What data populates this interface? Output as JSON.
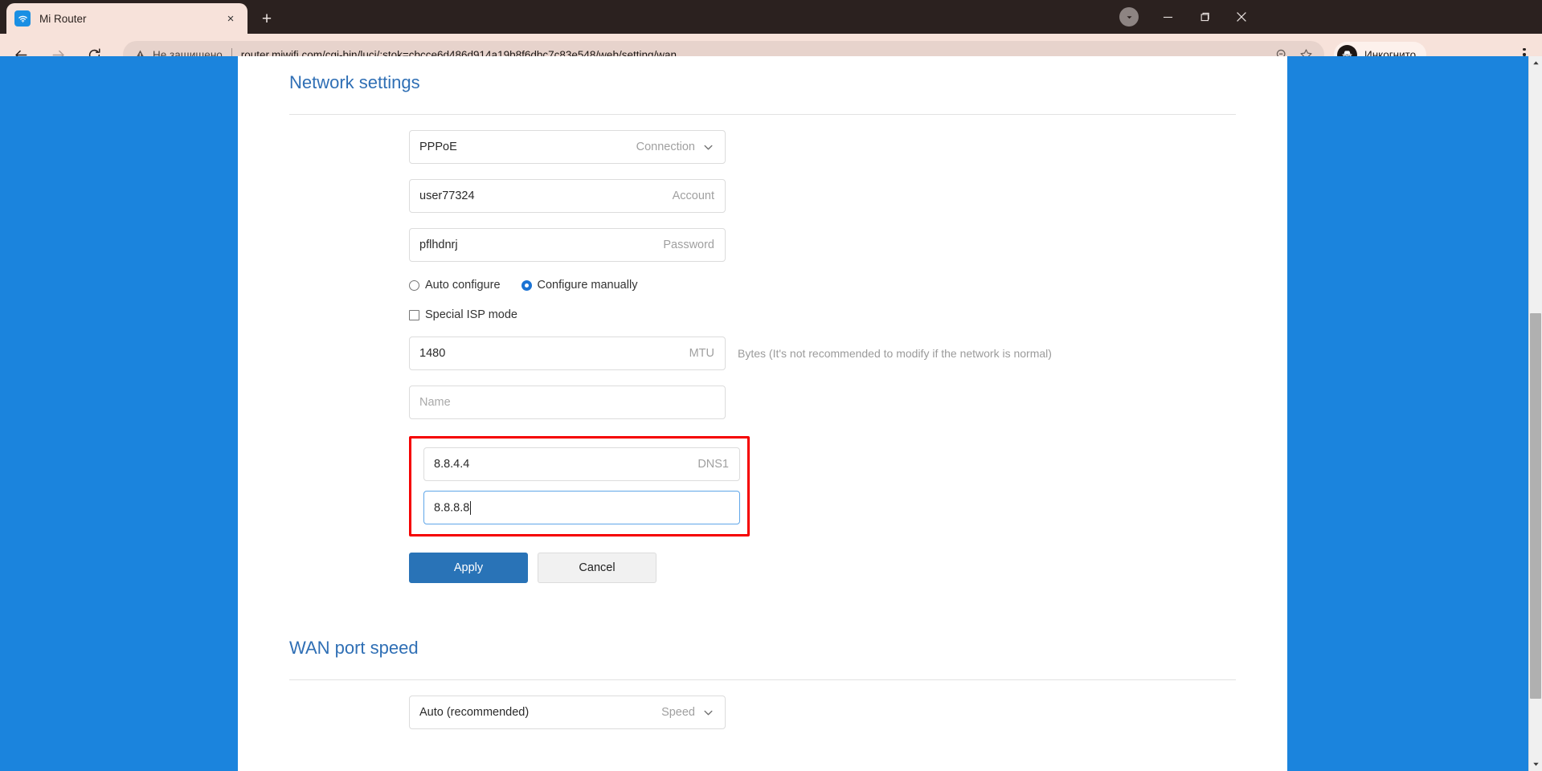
{
  "browser": {
    "tab": {
      "title": "Mi Router",
      "favicon": "wifi-icon",
      "close": "×"
    },
    "new_tab_label": "+",
    "window_controls": {
      "minimize": "—",
      "maximize": "❐",
      "close": "✕"
    },
    "nav": {
      "back": "←",
      "forward": "→",
      "reload": "↻",
      "home": "⌂"
    },
    "omnibox": {
      "security_text": "Не защищено",
      "url": "router.miwifi.com/cgi-bin/luci/;stok=cbcce6d486d914a19b8f6dbc7c83e548/web/setting/wan",
      "zoom_icon": "zoom-out-icon",
      "bookmark_icon": "star-icon"
    },
    "incognito_label": "Инкогнито"
  },
  "page": {
    "network_settings": {
      "title": "Network settings",
      "connection": {
        "value": "PPPoE",
        "label": "Connection"
      },
      "account": {
        "value": "user77324",
        "label": "Account"
      },
      "password": {
        "value": "pflhdnrj",
        "label": "Password"
      },
      "config_mode": {
        "auto": {
          "label": "Auto configure",
          "checked": false
        },
        "manual": {
          "label": "Configure manually",
          "checked": true
        }
      },
      "special_isp": {
        "label": "Special ISP mode",
        "checked": false
      },
      "mtu": {
        "value": "1480",
        "label": "MTU",
        "hint": "Bytes (It's not recommended to modify if the network is normal)"
      },
      "name": {
        "value": "",
        "placeholder": "Name",
        "label": ""
      },
      "dns1": {
        "value": "8.8.4.4",
        "label": "DNS1"
      },
      "dns2": {
        "value": "8.8.8.8",
        "label": "",
        "focused": true
      },
      "apply_label": "Apply",
      "cancel_label": "Cancel"
    },
    "wan_port_speed": {
      "title": "WAN port speed",
      "speed": {
        "value": "Auto (recommended)",
        "label": "Speed"
      }
    }
  },
  "colors": {
    "accent_blue": "#2f6fb5",
    "page_background": "#1b84dd",
    "highlight_red": "#f50000",
    "apply_button": "#2973b7"
  }
}
